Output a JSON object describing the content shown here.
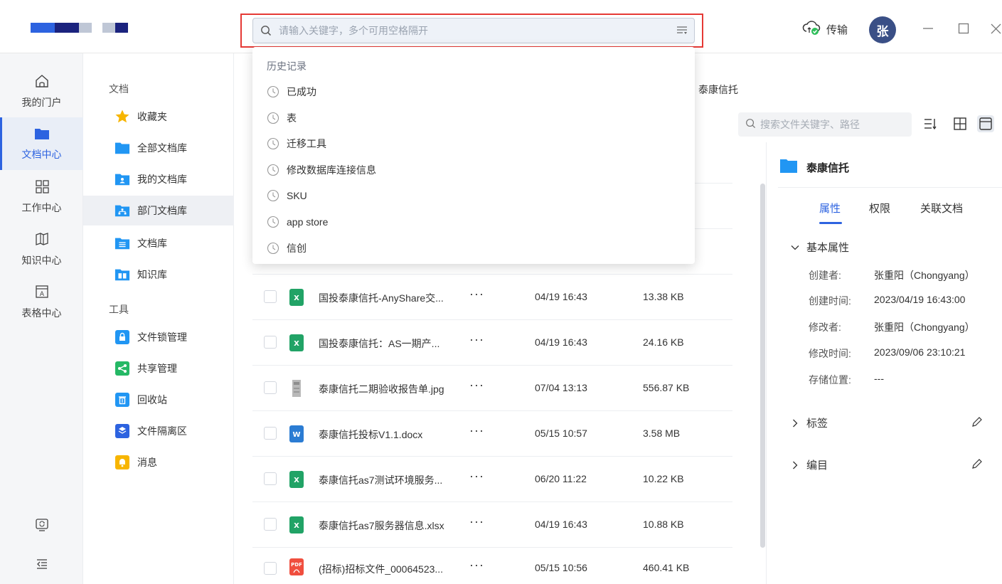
{
  "colors": {
    "accent": "#2d63e0",
    "highlight_border": "#e53935",
    "avatar_bg": "#3a4f86",
    "logo_blue": "#2d63e0",
    "logo_navy": "#1b237e",
    "logo_light": "#bfc7d6"
  },
  "header": {
    "search_placeholder": "请输入关键字，多个可用空格隔开",
    "transfer_label": "传输",
    "avatar_text": "张"
  },
  "history": {
    "title": "历史记录",
    "items": [
      "已成功",
      "表",
      "迁移工具",
      "修改数据库连接信息",
      "SKU",
      "app store",
      "信创"
    ]
  },
  "nav1": {
    "items": [
      {
        "label": "我的门户",
        "icon": "home-icon"
      },
      {
        "label": "文档中心",
        "icon": "folder-icon"
      },
      {
        "label": "工作中心",
        "icon": "grid-icon"
      },
      {
        "label": "知识中心",
        "icon": "book-icon"
      },
      {
        "label": "表格中心",
        "icon": "table-icon"
      }
    ],
    "active": 1
  },
  "nav2": {
    "group_docs": "文档",
    "group_tools": "工具",
    "docs": [
      {
        "label": "收藏夹",
        "icon": "star-icon"
      },
      {
        "label": "全部文档库",
        "icon": "folder-icon"
      },
      {
        "label": "我的文档库",
        "icon": "user-folder-icon"
      },
      {
        "label": "部门文档库",
        "icon": "org-folder-icon"
      },
      {
        "label": "文档库",
        "icon": "doc-folder-icon"
      },
      {
        "label": "知识库",
        "icon": "book-folder-icon"
      }
    ],
    "tools": [
      {
        "label": "文件锁管理",
        "icon": "lock-icon"
      },
      {
        "label": "共享管理",
        "icon": "share-icon"
      },
      {
        "label": "回收站",
        "icon": "trash-icon"
      },
      {
        "label": "文件隔离区",
        "icon": "shield-icon"
      },
      {
        "label": "消息",
        "icon": "bell-icon"
      }
    ],
    "active": "部门文档库"
  },
  "main": {
    "breadcrumb_tail": "泰康信托",
    "file_search_placeholder": "搜索文件关键字、路径",
    "files": [
      {
        "name": "国投泰康信托-AnyShare交...",
        "more": "···",
        "time": "04/19 16:43",
        "size": "13.38 KB",
        "type": "xlsx"
      },
      {
        "name": "国投泰康信托：AS一期产...",
        "more": "···",
        "time": "04/19 16:43",
        "size": "24.16 KB",
        "type": "xlsx"
      },
      {
        "name": "泰康信托二期验收报告单.jpg",
        "more": "···",
        "time": "07/04 13:13",
        "size": "556.87 KB",
        "type": "jpg"
      },
      {
        "name": "泰康信托投标V1.1.docx",
        "more": "···",
        "time": "05/15 10:57",
        "size": "3.58 MB",
        "type": "docx"
      },
      {
        "name": "泰康信托as7测试环境服务...",
        "more": "···",
        "time": "06/20 11:22",
        "size": "10.22 KB",
        "type": "xlsx"
      },
      {
        "name": "泰康信托as7服务器信息.xlsx",
        "more": "···",
        "time": "04/19 16:43",
        "size": "10.88 KB",
        "type": "xlsx"
      },
      {
        "name": "(招标)招标文件_00064523...",
        "more": "···",
        "time": "05/15 10:56",
        "size": "460.41 KB",
        "type": "pdf"
      }
    ]
  },
  "detail": {
    "title": "泰康信托",
    "tabs": [
      "属性",
      "权限",
      "关联文档"
    ],
    "active_tab": "属性",
    "section_basic": "基本属性",
    "props": [
      {
        "k": "创建者:",
        "v": "张重阳（Chongyang）"
      },
      {
        "k": "创建时间:",
        "v": "2023/04/19 16:43:00"
      },
      {
        "k": "修改者:",
        "v": "张重阳（Chongyang）"
      },
      {
        "k": "修改时间:",
        "v": "2023/09/06 23:10:21"
      },
      {
        "k": "存储位置:",
        "v": "---"
      }
    ],
    "section_tags": "标签",
    "section_catalog": "编目"
  },
  "file_type_badges": {
    "xlsx": "X",
    "docx": "W",
    "pdf": "PDF"
  }
}
